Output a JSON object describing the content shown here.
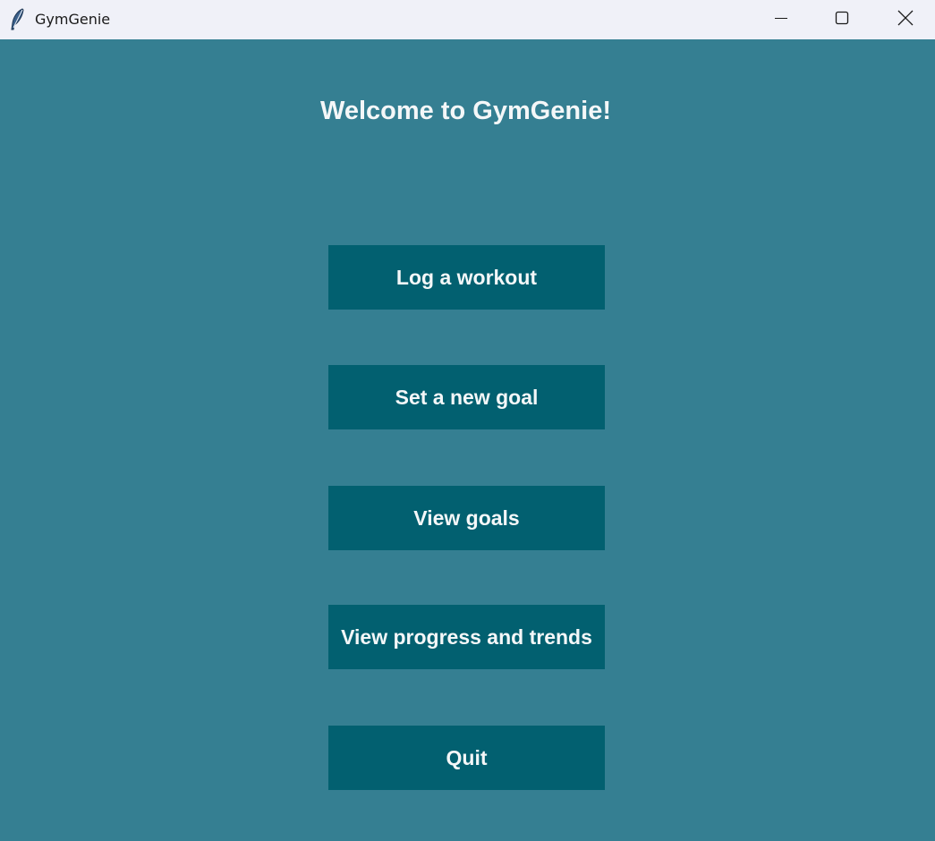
{
  "window": {
    "title": "GymGenie",
    "icon": "feather-icon",
    "controls": [
      "minimize-icon",
      "maximize-icon",
      "close-icon"
    ]
  },
  "main": {
    "welcome": "Welcome to GymGenie!",
    "buttons": [
      {
        "label": "Log a workout"
      },
      {
        "label": "Set a new goal"
      },
      {
        "label": "View goals"
      },
      {
        "label": "View progress and trends"
      },
      {
        "label": "Quit"
      }
    ]
  },
  "colors": {
    "background": "#357F92",
    "button": "#026070",
    "text": "#F4F7F8",
    "titlebar": "#F0F1F8"
  }
}
